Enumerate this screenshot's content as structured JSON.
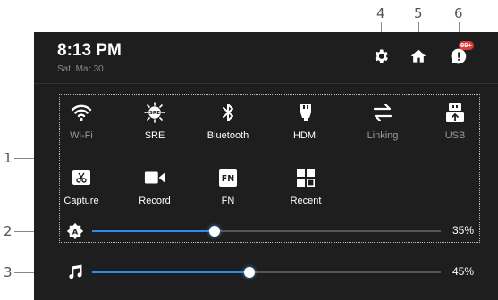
{
  "callouts": [
    "1",
    "2",
    "3",
    "4",
    "5",
    "6"
  ],
  "status": {
    "time": "8:13 PM",
    "date": "Sat, Mar 30"
  },
  "header_icons": {
    "settings": "gear-icon",
    "home": "home-icon",
    "notifications": {
      "icon": "alert-bubble-icon",
      "badge": "99+"
    }
  },
  "quick_tiles": [
    {
      "label": "Wi-Fi",
      "icon": "wifi-icon",
      "active": false
    },
    {
      "label": "SRE",
      "icon": "sre-icon",
      "active": true
    },
    {
      "label": "Bluetooth",
      "icon": "bluetooth-icon",
      "active": true
    },
    {
      "label": "HDMI",
      "icon": "hdmi-icon",
      "active": true
    },
    {
      "label": "Linking",
      "icon": "linking-icon",
      "active": false
    },
    {
      "label": "USB",
      "icon": "usb-icon",
      "active": false
    },
    {
      "label": "Capture",
      "icon": "capture-icon",
      "active": false
    },
    {
      "label": "Record",
      "icon": "record-icon",
      "active": false
    },
    {
      "label": "FN",
      "icon": "fn-icon",
      "active": false
    },
    {
      "label": "Recent",
      "icon": "recent-icon",
      "active": false
    }
  ],
  "sliders": {
    "brightness": {
      "icon": "auto-brightness-icon",
      "value": "35%",
      "level": 0.35
    },
    "volume": {
      "icon": "music-note-icon",
      "value": "45%",
      "level": 0.45
    }
  },
  "colors": {
    "panel_bg": "#1e1e1e",
    "accent": "#2d8cf0",
    "badge": "#e53935"
  }
}
